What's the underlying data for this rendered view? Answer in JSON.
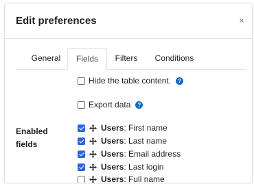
{
  "modal": {
    "title": "Edit preferences",
    "close_glyph": "×"
  },
  "tabs": [
    {
      "label": "General",
      "active": false
    },
    {
      "label": "Fields",
      "active": true
    },
    {
      "label": "Filters",
      "active": false
    },
    {
      "label": "Conditions",
      "active": false
    }
  ],
  "options": {
    "hide_table": {
      "label": "Hide the table content.",
      "checked": false
    },
    "export_data": {
      "label": "Export data",
      "checked": false
    },
    "help_glyph": "?"
  },
  "enabled_fields": {
    "label_line1": "Enabled",
    "label_line2": "fields",
    "items": [
      {
        "prefix": "Users",
        "sep": ":",
        "name": " First name",
        "checked": true
      },
      {
        "prefix": "Users",
        "sep": ":",
        "name": " Last name",
        "checked": true
      },
      {
        "prefix": "Users",
        "sep": ":",
        "name": " Email address",
        "checked": true
      },
      {
        "prefix": "Users",
        "sep": ":",
        "name": " Last login",
        "checked": true
      },
      {
        "prefix": "Users",
        "sep": ":",
        "name": " Full name",
        "checked": false
      }
    ]
  },
  "colors": {
    "accent": "#2c66d8",
    "help": "#0f6cbf"
  },
  "icons": {
    "close": "close-icon",
    "help": "help-icon",
    "move": "move-icon"
  }
}
